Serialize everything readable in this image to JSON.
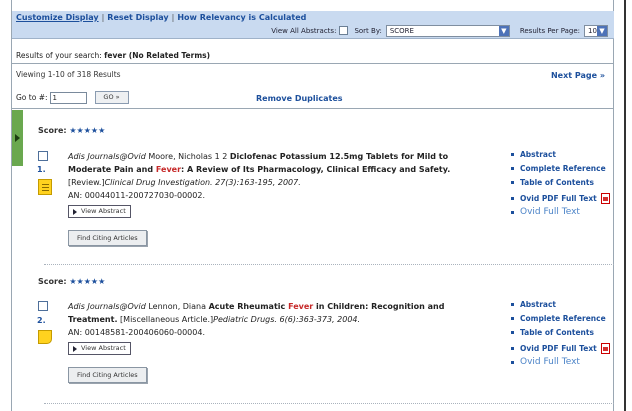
{
  "toolbar": {
    "links": [
      "Customize Display",
      "Reset Display",
      "How Relevancy is Calculated"
    ],
    "view_all_abstracts_label": "View All Abstracts:",
    "sort_by_label": "Sort By:",
    "sort_by_value": "SCORE",
    "results_per_page_label": "Results Per Page:",
    "results_per_page_value": "10"
  },
  "search": {
    "prefix": "Results of your search:",
    "query": "fever (No Related Terms)"
  },
  "paging": {
    "viewing": "Viewing 1-10 of 318 Results",
    "next_page": "Next Page »",
    "goto_label": "Go to #:",
    "goto_value": "1",
    "go_button": "GO »",
    "remove_duplicates": "Remove Duplicates"
  },
  "colors": {
    "accent": "#1c4f9c",
    "highlight": "#c62828",
    "toolbar_bg": "#c9daf0",
    "tab_green": "#6aa84f"
  },
  "results": [
    {
      "score_label": "Score:",
      "stars": "★★★★★",
      "number": "1.",
      "source": "Adis Journals@Ovid",
      "authors": "Moore, Nicholas 1 2",
      "title_pre": "Diclofenac Potassium 12.5mg Tablets for Mild to Moderate Pain and",
      "title_hl": "Fever",
      "title_post": ": A Review of Its Pharmacology, Clinical Efficacy and Safety.",
      "type": "[Review.]",
      "journal": "Clinical Drug Investigation. 27(3):163-195, 2007.",
      "an": "AN: 00044011-200727030-00002.",
      "view_abstract": "View Abstract",
      "find_citing": "Find Citing Articles",
      "links": [
        "Abstract",
        "Complete Reference",
        "Table of Contents",
        "Ovid PDF Full Text",
        "Ovid Full Text"
      ],
      "icon": "document-icon"
    },
    {
      "score_label": "Score:",
      "stars": "★★★★★",
      "number": "2.",
      "source": "Adis Journals@Ovid",
      "authors": "Lennon, Diana",
      "title_pre": "Acute Rheumatic",
      "title_hl": "Fever",
      "title_post": "in Children: Recognition and Treatment.",
      "type": "[Miscellaneous Article.]",
      "journal": "Pediatric Drugs. 6(6):363-373, 2004.",
      "an": "AN: 00148581-200406060-00004.",
      "view_abstract": "View Abstract",
      "find_citing": "Find Citing Articles",
      "links": [
        "Abstract",
        "Complete Reference",
        "Table of Contents",
        "Ovid PDF Full Text",
        "Ovid Full Text"
      ],
      "icon": "note-icon"
    }
  ]
}
